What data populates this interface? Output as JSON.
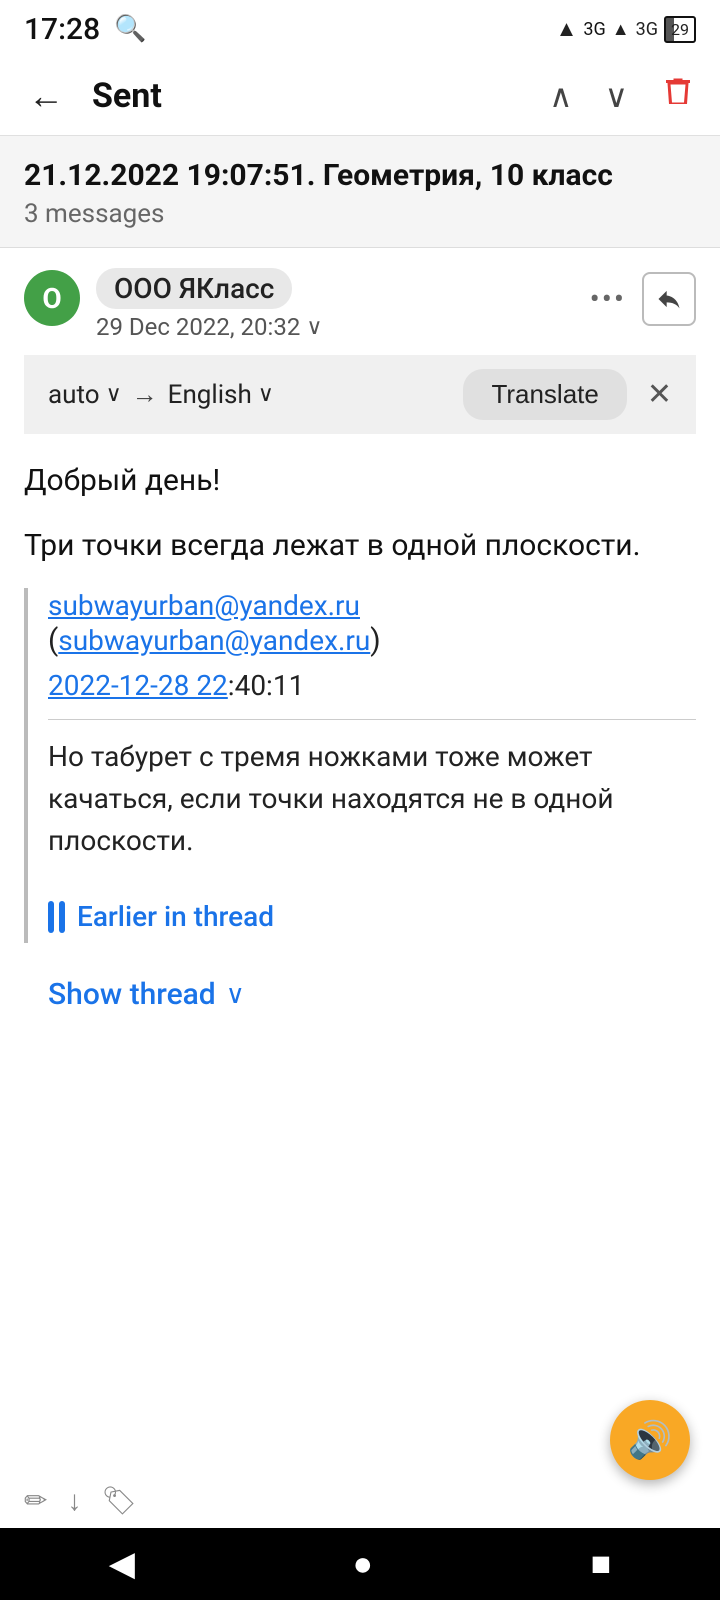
{
  "statusBar": {
    "time": "17:28",
    "searchIcon": "🔍",
    "batteryLevel": "29"
  },
  "appBar": {
    "title": "Sent",
    "backIcon": "←",
    "upIcon": "∧",
    "downIcon": "∨",
    "deleteIcon": "🗑"
  },
  "threadHeader": {
    "title": "21.12.2022 19:07:51. Геометрия, 10 класс",
    "messageCount": "3 messages"
  },
  "email": {
    "senderAvatar": "O",
    "senderName": "ООО ЯКласс",
    "date": "29 Dec 2022, 20:32",
    "moreIcon": "•••",
    "replyIcon": "↩"
  },
  "translateBar": {
    "fromLang": "auto",
    "toLang": "English",
    "translateBtn": "Translate",
    "arrowIcon": "→",
    "closeIcon": "✕"
  },
  "emailBody": {
    "greeting": "Добрый день!",
    "mainText": "Три точки всегда лежат в одной плоскости."
  },
  "quotedBlock": {
    "emailLink": "subwayurban@yandex.ru",
    "emailParenLink": "subwayurban@yandex.ru",
    "dateLink": "2022-12-28 22",
    "datePlain": ":40:11",
    "bodyText": "Но табурет с тремя ножками тоже может качаться, если точки находятся не в одной плоскости."
  },
  "earlierInThread": {
    "label": "Earlier in thread"
  },
  "showThread": {
    "label": "Show thread",
    "chevron": "∨"
  },
  "fab": {
    "icon": "🔊"
  },
  "navBar": {
    "backBtn": "◀",
    "homeBtn": "●",
    "recentBtn": "■"
  }
}
